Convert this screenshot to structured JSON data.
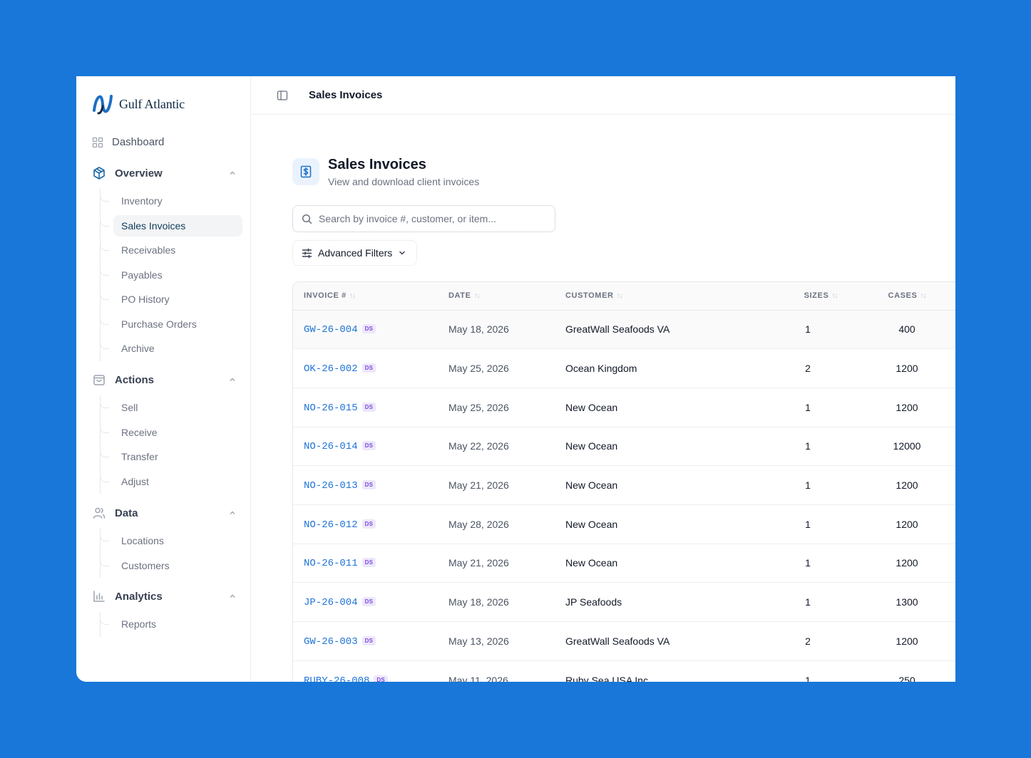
{
  "brand": {
    "name": "Gulf Atlantic"
  },
  "sidebar": {
    "dashboard_label": "Dashboard",
    "sections": [
      {
        "label": "Overview",
        "items": [
          "Inventory",
          "Sales Invoices",
          "Receivables",
          "Payables",
          "PO History",
          "Purchase Orders",
          "Archive"
        ]
      },
      {
        "label": "Actions",
        "items": [
          "Sell",
          "Receive",
          "Transfer",
          "Adjust"
        ]
      },
      {
        "label": "Data",
        "items": [
          "Locations",
          "Customers"
        ]
      },
      {
        "label": "Analytics",
        "items": [
          "Reports"
        ]
      }
    ],
    "active_item": "Sales Invoices"
  },
  "topbar": {
    "title": "Sales Invoices"
  },
  "page": {
    "title": "Sales Invoices",
    "subtitle": "View and download client invoices",
    "search_placeholder": "Search by invoice #, customer, or item...",
    "filters_label": "Advanced Filters"
  },
  "table": {
    "columns": [
      "INVOICE #",
      "DATE",
      "CUSTOMER",
      "SIZES",
      "CASES"
    ],
    "badge": "DS",
    "rows": [
      {
        "invoice": "GW-26-004",
        "date": "May 18, 2026",
        "customer": "GreatWall Seafoods VA",
        "sizes": "1",
        "cases": "400"
      },
      {
        "invoice": "OK-26-002",
        "date": "May 25, 2026",
        "customer": "Ocean Kingdom",
        "sizes": "2",
        "cases": "1200"
      },
      {
        "invoice": "NO-26-015",
        "date": "May 25, 2026",
        "customer": "New Ocean",
        "sizes": "1",
        "cases": "1200"
      },
      {
        "invoice": "NO-26-014",
        "date": "May 22, 2026",
        "customer": "New Ocean",
        "sizes": "1",
        "cases": "12000"
      },
      {
        "invoice": "NO-26-013",
        "date": "May 21, 2026",
        "customer": "New Ocean",
        "sizes": "1",
        "cases": "1200"
      },
      {
        "invoice": "NO-26-012",
        "date": "May 28, 2026",
        "customer": "New Ocean",
        "sizes": "1",
        "cases": "1200"
      },
      {
        "invoice": "NO-26-011",
        "date": "May 21, 2026",
        "customer": "New Ocean",
        "sizes": "1",
        "cases": "1200"
      },
      {
        "invoice": "JP-26-004",
        "date": "May 18, 2026",
        "customer": "JP Seafoods",
        "sizes": "1",
        "cases": "1300"
      },
      {
        "invoice": "GW-26-003",
        "date": "May 13, 2026",
        "customer": "GreatWall Seafoods VA",
        "sizes": "2",
        "cases": "1200"
      },
      {
        "invoice": "RUBY-26-008",
        "date": "May 11, 2026",
        "customer": "Ruby Sea USA Inc",
        "sizes": "1",
        "cases": "250"
      }
    ]
  },
  "colors": {
    "background": "#1877D9",
    "link": "#1f73d6",
    "badge_bg": "#ede7fb",
    "badge_text": "#7c4ddb"
  }
}
